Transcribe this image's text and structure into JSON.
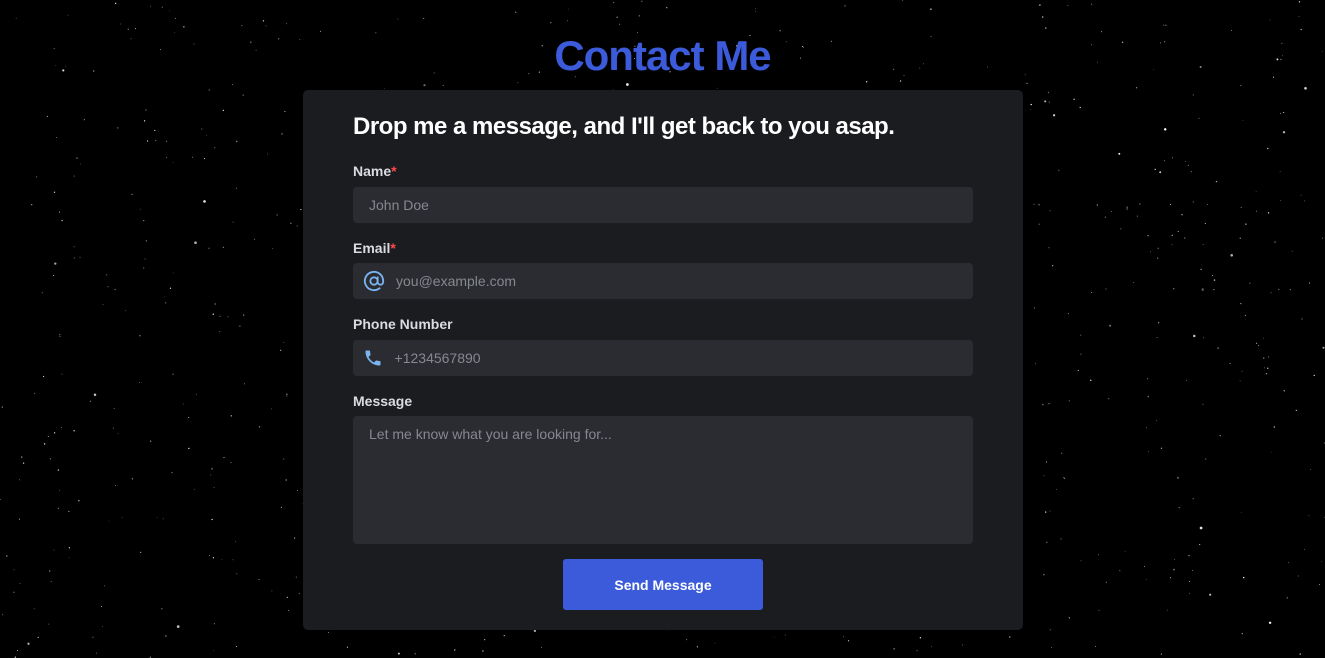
{
  "colors": {
    "accent": "#3b5bdb",
    "card": "#1b1c20",
    "input": "#2b2c31",
    "icon": "#7ab3ef",
    "required": "#ff4a4a"
  },
  "page": {
    "title": "Contact Me"
  },
  "form": {
    "heading": "Drop me a message, and I'll get back to you asap.",
    "name": {
      "label": "Name",
      "required_mark": "*",
      "placeholder": "John Doe",
      "value": ""
    },
    "email": {
      "label": "Email",
      "required_mark": "*",
      "icon": "at-sign-icon",
      "placeholder": "you@example.com",
      "value": ""
    },
    "phone": {
      "label": "Phone Number",
      "icon": "phone-icon",
      "placeholder": "+1234567890",
      "value": ""
    },
    "message": {
      "label": "Message",
      "placeholder": "Let me know what you are looking for...",
      "value": ""
    },
    "submit_label": "Send Message"
  }
}
